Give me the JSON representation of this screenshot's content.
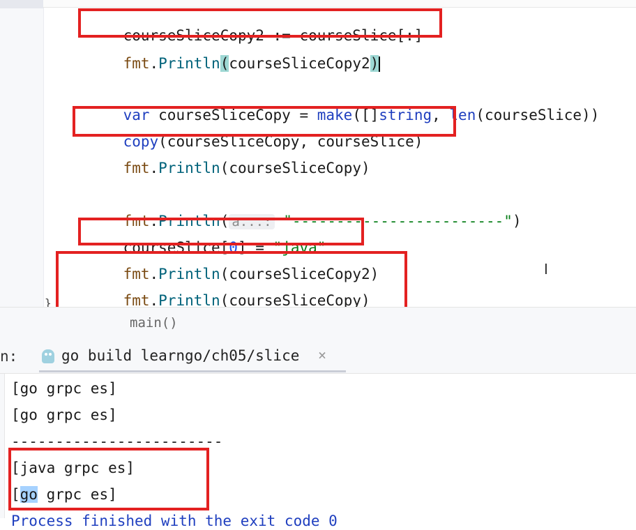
{
  "editor": {
    "lines": {
      "l1": "courseSliceCopy2 := courseSlice[:]",
      "l2_pkg": "fmt",
      "l2_dot": ".",
      "l2_fn": "Println",
      "l2_open": "(",
      "l2_arg": "courseSliceCopy2",
      "l2_close": ")",
      "l3_kw": "var",
      "l3_rest1": " courseSliceCopy = ",
      "l3_make": "make",
      "l3_rest2": "([]",
      "l3_type": "string",
      "l3_rest3": ", ",
      "l3_len": "len",
      "l3_rest4": "(courseSlice))",
      "l4_fn": "copy",
      "l4_rest": "(courseSliceCopy, courseSlice)",
      "l5_pkg": "fmt",
      "l5_dot": ".",
      "l5_fn": "Println",
      "l5_rest": "(courseSliceCopy)",
      "l6_pkg": "fmt",
      "l6_dot": ".",
      "l6_fn": "Println",
      "l6_open": "(",
      "l6_hint": "a...:",
      "l6_str": "\"------------------------\"",
      "l6_close": ")",
      "l7_a": "courseSlice[",
      "l7_num": "0",
      "l7_b": "] = ",
      "l7_str": "\"java\"",
      "l8_pkg": "fmt",
      "l8_dot": ".",
      "l8_fn": "Println",
      "l8_rest": "(courseSliceCopy2)",
      "l9_pkg": "fmt",
      "l9_dot": ".",
      "l9_fn": "Println",
      "l9_rest": "(courseSliceCopy)",
      "brace": "}"
    },
    "breadcrumb": "main()",
    "mouse_cursor": "I"
  },
  "run_panel": {
    "prefix": "n:",
    "tab_label": "go build learngo/ch05/slice",
    "tab_icon": "gopher-icon",
    "close_glyph": "×"
  },
  "console": {
    "line1": "[go grpc es]",
    "line2": "[go grpc es]",
    "line3": "------------------------",
    "line4": "[java grpc es]",
    "line5_a": "[",
    "line5_sel": "go",
    "line5_b": " grpc es]",
    "line6": "Process finished with the exit code 0"
  },
  "colors": {
    "annotation_red": "#e32121",
    "keyword_blue": "#1f3fbf",
    "string_green": "#067d17",
    "selection": "#a6d2ff"
  }
}
